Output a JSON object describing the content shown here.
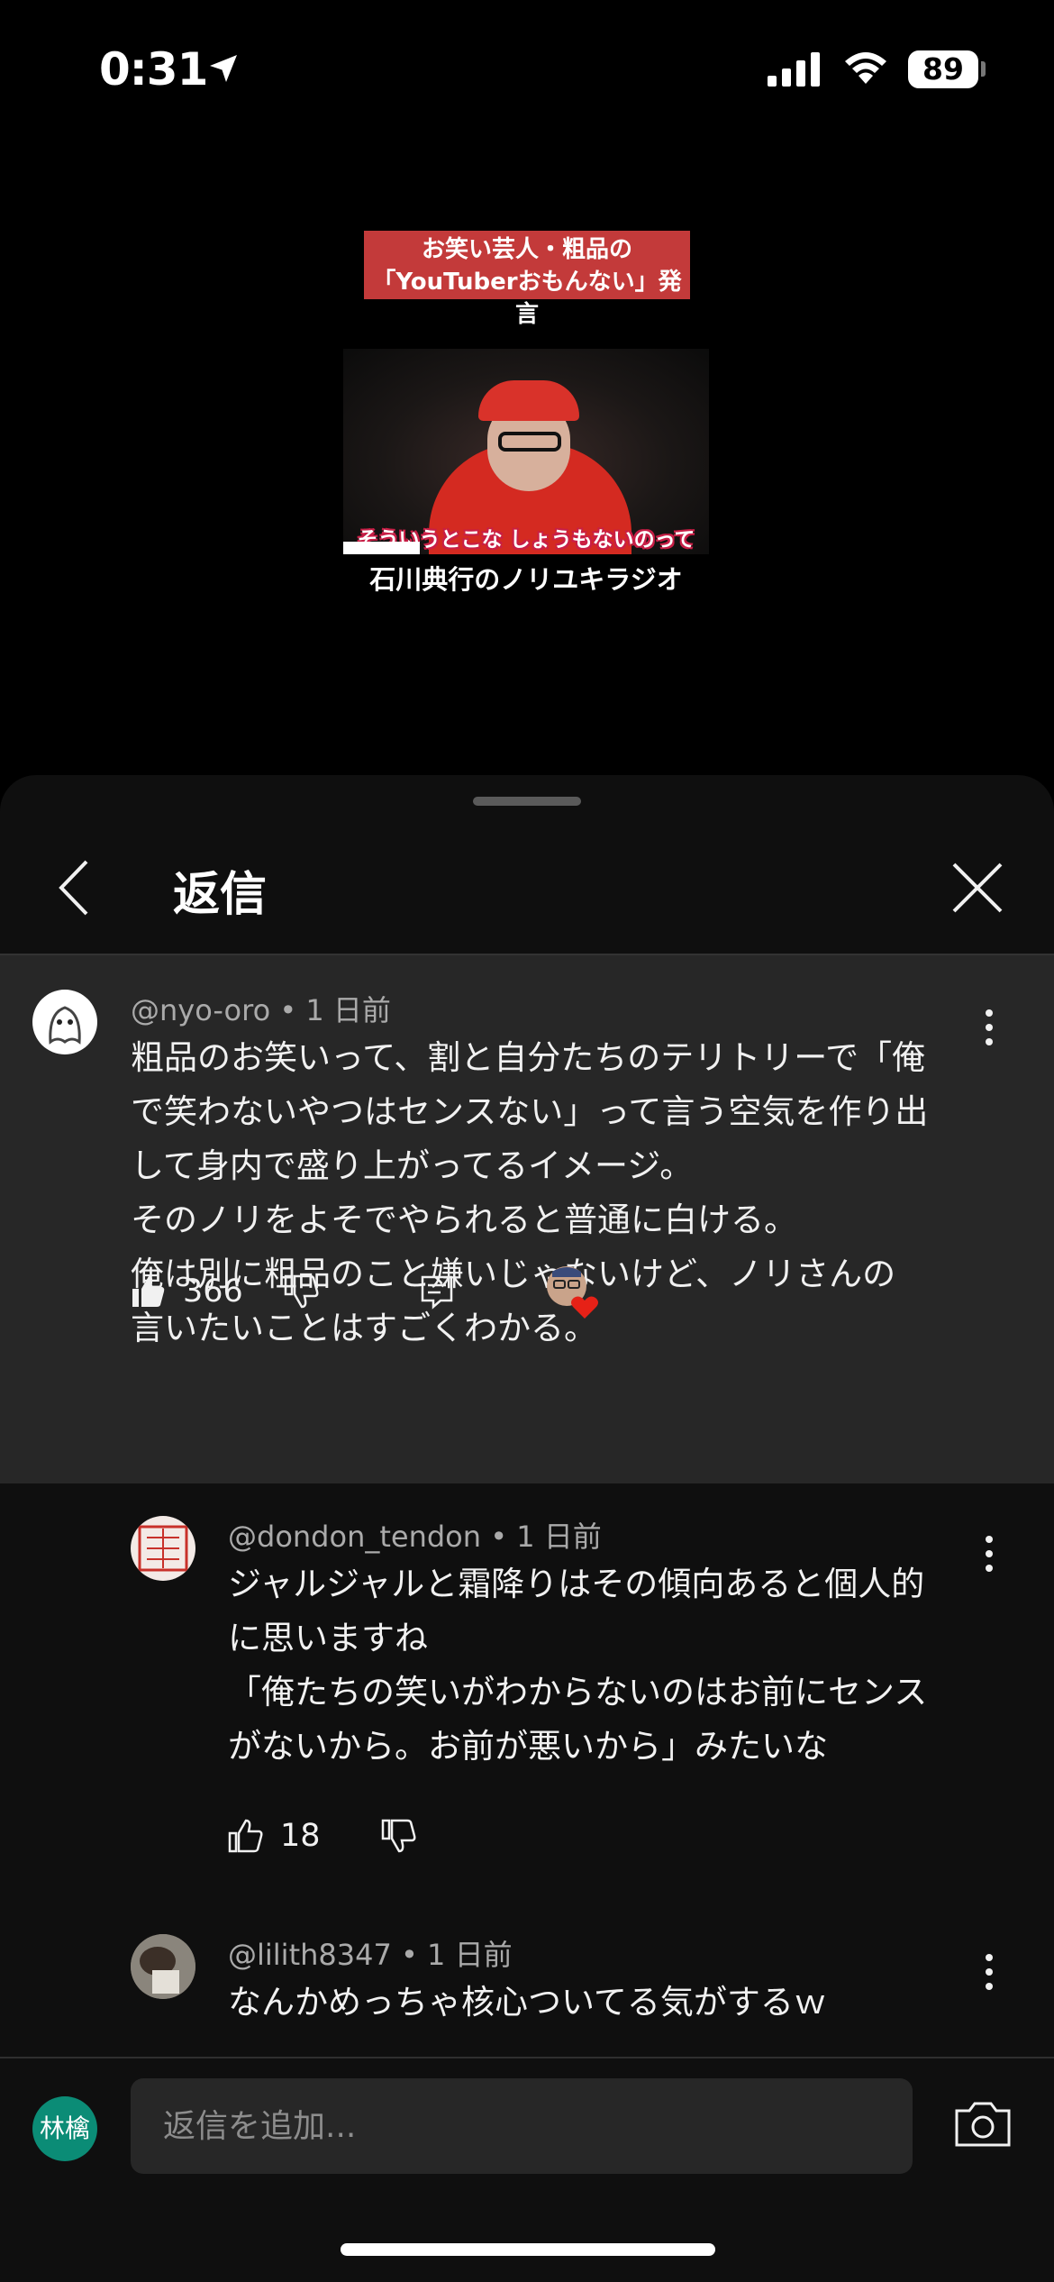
{
  "status_bar": {
    "time": "0:31",
    "battery": "89"
  },
  "video": {
    "banner_line1": "お笑い芸人・粗品の",
    "banner_line2": "「YouTuberおもんない」発言",
    "subtitle": "そういうとこな しょうもないのって",
    "channel_caption": "石川典行のノリユキラジオ"
  },
  "sheet": {
    "title": "返信"
  },
  "parent_comment": {
    "handle": "@nyo-oro",
    "time": " • 1 日前",
    "text": "粗品のお笑いって、割と自分たちのテリトリーで「俺\nで笑わないやつはセンスない」って言う空気を作り出\nして身内で盛り上がってるイメージ。\nそのノリをよそでやられると普通に白ける。\n俺は別に粗品のこと嫌いじゃないけど、ノリさんの\n言いたいことはすごくわかる。",
    "likes": "366"
  },
  "replies": [
    {
      "handle": "@dondon_tendon",
      "time": " • 1 日前",
      "text": "ジャルジャルと霜降りはその傾向あると個人的\nに思いますね\n「俺たちの笑いがわからないのはお前にセンス\nがないから。お前が悪いから」みたいな",
      "likes": "18"
    },
    {
      "handle": "@lilith8347",
      "time": " • 1 日前",
      "text": "なんかめっちゃ核心ついてる気がするｗ"
    }
  ],
  "input": {
    "placeholder": "返信を追加...",
    "my_avatar_text": "林檎"
  },
  "colors": {
    "sheet_bg": "#0f0f0f",
    "highlight_bg": "#272727",
    "heart": "#e62117",
    "avatar_green": "#0b8c76"
  }
}
